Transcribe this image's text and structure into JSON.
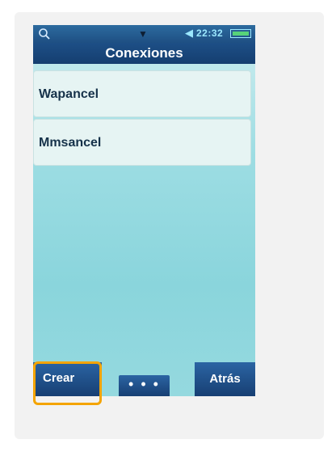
{
  "statusbar": {
    "search_icon": "search-icon",
    "chevron_icon": "chevron-down-icon",
    "volume_icon": "volume-icon",
    "time": "22:32",
    "battery_icon": "battery-icon"
  },
  "header": {
    "title": "Conexiones"
  },
  "connections": [
    {
      "label": "Wapancel"
    },
    {
      "label": "Mmsancel"
    }
  ],
  "softkeys": {
    "create_label": "Crear",
    "more_label": "• • •",
    "back_label": "Atrás"
  },
  "colors": {
    "title_bar": "#1d4f86",
    "background": "#9ddde3",
    "highlight": "#f4a400"
  }
}
